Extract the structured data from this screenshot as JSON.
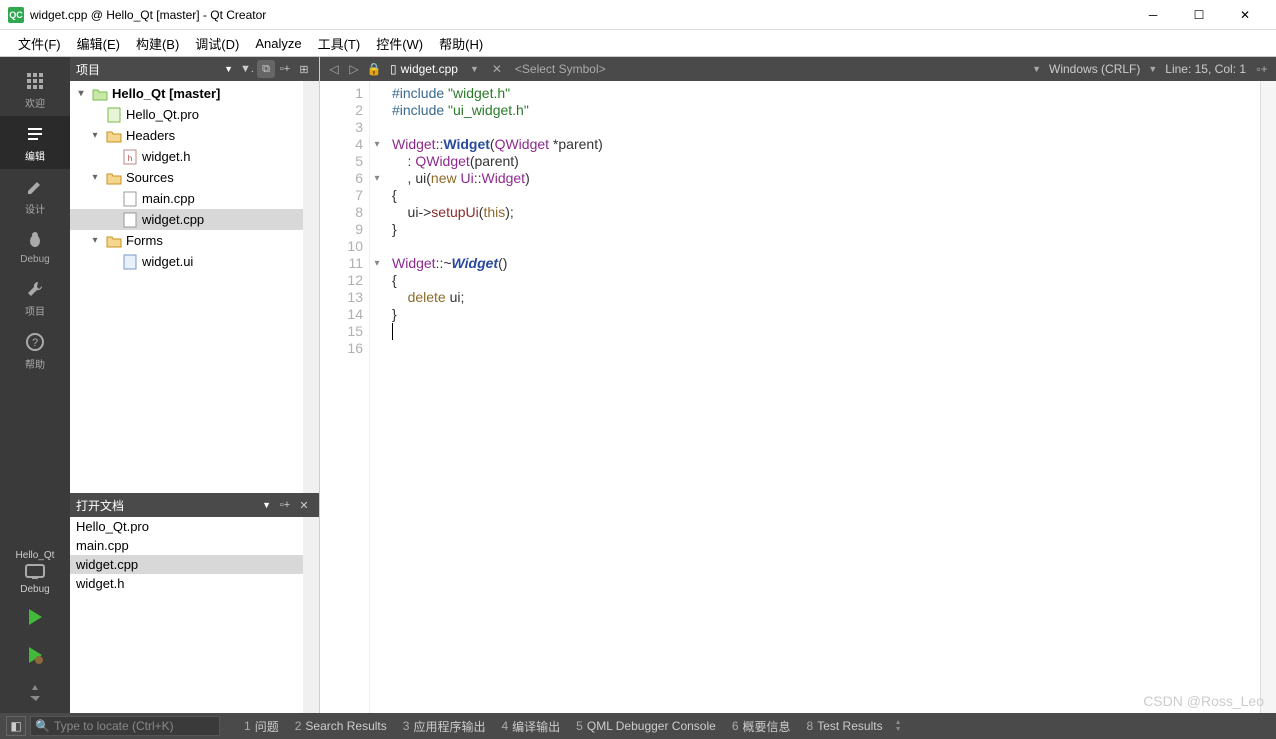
{
  "window": {
    "title": "widget.cpp @ Hello_Qt [master] - Qt Creator",
    "app_badge": "QC"
  },
  "menubar": [
    "文件(F)",
    "编辑(E)",
    "构建(B)",
    "调试(D)",
    "Analyze",
    "工具(T)",
    "控件(W)",
    "帮助(H)"
  ],
  "leftbar": {
    "modes": [
      {
        "icon": "grid",
        "label": "欢迎"
      },
      {
        "icon": "edit",
        "label": "编辑",
        "active": true
      },
      {
        "icon": "pencil",
        "label": "设计"
      },
      {
        "icon": "bug",
        "label": "Debug"
      },
      {
        "icon": "wrench",
        "label": "项目"
      },
      {
        "icon": "help",
        "label": "帮助"
      }
    ],
    "project_label": "Hello_Qt",
    "config_label": "Debug"
  },
  "projects_pane": {
    "title": "项目",
    "tree": [
      {
        "level": 0,
        "exp": "▾",
        "icon": "folder-green",
        "text": "Hello_Qt [master]",
        "bold": true
      },
      {
        "level": 1,
        "exp": "",
        "icon": "pro",
        "text": "Hello_Qt.pro"
      },
      {
        "level": 1,
        "exp": "▾",
        "icon": "folder-h",
        "text": "Headers"
      },
      {
        "level": 2,
        "exp": "",
        "icon": "h-file",
        "text": "widget.h"
      },
      {
        "level": 1,
        "exp": "▾",
        "icon": "folder-cpp",
        "text": "Sources"
      },
      {
        "level": 2,
        "exp": "",
        "icon": "file",
        "text": "main.cpp"
      },
      {
        "level": 2,
        "exp": "",
        "icon": "file",
        "text": "widget.cpp",
        "selected": true
      },
      {
        "level": 1,
        "exp": "▾",
        "icon": "folder-ui",
        "text": "Forms"
      },
      {
        "level": 2,
        "exp": "",
        "icon": "ui-file",
        "text": "widget.ui"
      }
    ]
  },
  "opendocs": {
    "title": "打开文档",
    "items": [
      {
        "text": "Hello_Qt.pro"
      },
      {
        "text": "main.cpp"
      },
      {
        "text": "widget.cpp",
        "selected": true
      },
      {
        "text": "widget.h"
      }
    ]
  },
  "editor": {
    "filename": "widget.cpp",
    "symbol": "<Select Symbol>",
    "encoding": "Windows (CRLF)",
    "position": "Line: 15, Col: 1",
    "lines": [
      {
        "n": 1,
        "html": "<span class='kw-pp'>#include</span> <span class='kw-str'>\"widget.h\"</span>"
      },
      {
        "n": 2,
        "html": "<span class='kw-pp'>#include</span> <span class='kw-str'>\"ui_widget.h\"</span>"
      },
      {
        "n": 3,
        "html": ""
      },
      {
        "n": 4,
        "fold": "▾",
        "html": "<span class='kw-type'>Widget</span>::<span class='kw-func'>Widget</span>(<span class='kw-type'>QWidget</span> *parent)"
      },
      {
        "n": 5,
        "html": "    : <span class='kw-type'>QWidget</span>(parent)"
      },
      {
        "n": 6,
        "fold": "▾",
        "html": "    , ui(<span class='kw-new'>new</span> <span class='kw-type'>Ui</span>::<span class='kw-type'>Widget</span>)"
      },
      {
        "n": 7,
        "html": "{"
      },
      {
        "n": 8,
        "html": "    ui-><span class='kw-mem'>setupUi</span>(<span class='kw-this'>this</span>);"
      },
      {
        "n": 9,
        "html": "}"
      },
      {
        "n": 10,
        "html": ""
      },
      {
        "n": 11,
        "fold": "▾",
        "html": "<span class='kw-type'>Widget</span>::~<span class='kw-funci'>Widget</span>()"
      },
      {
        "n": 12,
        "html": "{"
      },
      {
        "n": 13,
        "html": "    <span class='kw-new'>delete</span> ui;"
      },
      {
        "n": 14,
        "html": "}"
      },
      {
        "n": 15,
        "html": "",
        "cursor": true
      },
      {
        "n": 16,
        "html": ""
      }
    ]
  },
  "statusbar": {
    "locator_placeholder": "Type to locate (Ctrl+K)",
    "tabs": [
      {
        "num": "1",
        "label": "问题"
      },
      {
        "num": "2",
        "label": "Search Results"
      },
      {
        "num": "3",
        "label": "应用程序输出"
      },
      {
        "num": "4",
        "label": "编译输出"
      },
      {
        "num": "5",
        "label": "QML Debugger Console"
      },
      {
        "num": "6",
        "label": "概要信息"
      },
      {
        "num": "8",
        "label": "Test Results"
      }
    ]
  },
  "watermark": "CSDN @Ross_Leo"
}
